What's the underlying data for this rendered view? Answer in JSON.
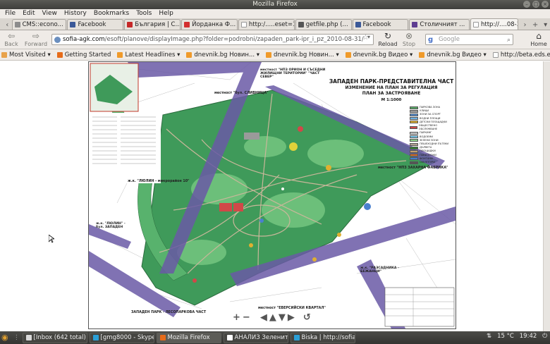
{
  "window": {
    "title": "Mozilla Firefox"
  },
  "menu": [
    "File",
    "Edit",
    "View",
    "History",
    "Bookmarks",
    "Tools",
    "Help"
  ],
  "tabs": [
    {
      "label": "CMS::econo...",
      "color": "#8c8c8c",
      "active": false
    },
    {
      "label": "Facebook",
      "color": "#3b5998",
      "active": false
    },
    {
      "label": "България | С...",
      "color": "#c62828",
      "active": false
    },
    {
      "label": "Йорданка Ф...",
      "color": "#d32f2f",
      "active": false
    },
    {
      "label": "http:/.....eset=1",
      "color": "#ffffff",
      "active": false
    },
    {
      "label": "getfile.php (...",
      "color": "#555555",
      "active": false
    },
    {
      "label": "Facebook",
      "color": "#3b5998",
      "active": false
    },
    {
      "label": "Столичният ...",
      "color": "#5e3d91",
      "active": false
    },
    {
      "label": "http://....08-31/",
      "color": "#ffffff",
      "active": true
    }
  ],
  "nav": {
    "back": "Back",
    "forward": "Forward",
    "reload": "Reload",
    "stop": "Stop",
    "home": "Home",
    "url_domain": "sofia-agk.com",
    "url_path": "/esoft/planove/displayImage.php?folder=podrobni/zapaden_park-ipr_i_pz_2010-08-31/",
    "search_placeholder": "Google"
  },
  "bookmarks": [
    {
      "label": "Most Visited",
      "has_menu": true,
      "color": "#e8a24a"
    },
    {
      "label": "Getting Started",
      "has_menu": false,
      "color": "#e66b1a"
    },
    {
      "label": "Latest Headlines",
      "has_menu": true,
      "color": "#f09a2a"
    },
    {
      "label": "dnevnik.bg Новин...",
      "has_menu": true,
      "color": "#f09a2a"
    },
    {
      "label": "dnevnik.bg Новин...",
      "has_menu": true,
      "color": "#f09a2a"
    },
    {
      "label": "dnevnik.bg Видео",
      "has_menu": true,
      "color": "#f09a2a"
    },
    {
      "label": "dnevnik.bg Видео",
      "has_menu": true,
      "color": "#f09a2a"
    },
    {
      "label": "http://beta.eds.econ...",
      "has_menu": false,
      "color": "#ffffff"
    }
  ],
  "map": {
    "title": "ЗАПАДЕН ПАРК-ПРЕДСТАВИТЕЛНА ЧАСТ",
    "subtitle1": "ИЗМЕНЕНИЕ НА ПЛАН ЗА РЕГУЛАЦИЯ",
    "subtitle2": "ПЛАН ЗА ЗАСТРОЯВАНЕ",
    "scale": "М 1:1000",
    "labels": {
      "top_street": "местност \"НПЗ ОРИОН И СЪСЕДНИ ЖИЛИЩНИ ТЕРИТОРИИ\" \"ЧАСТ СЕВЕР\"",
      "bus": "местност \"бул. СЛИВНИЦА\"",
      "factory": "местност \"НПЗ ЗАХАРНА ФАБРИКА\"",
      "lyulin": "ж.к. \"ЛЮЛИН - микрорайон 10\"",
      "lyulin2": "ж.к. \"ЛЮЛИН\" - бул. ЗАПАДЕН",
      "raz": "ж.к. \"РАЗСАДНИКА - БЕЖАНЦИ\"",
      "bottom1": "ЗАПАДЕН ПАРК - ЛЕСОПАРКОВА ЧАСТ",
      "bottom2": "местност \"ЕВЕРСИЙСКИ КВАРТАЛ\""
    },
    "legend": [
      "ПАРКОВА ЗОНА",
      "УЛИЦИ",
      "ЗОНИ ЗА СПОРТ",
      "ВОДНИ ПЛОЩИ",
      "ДЕТСКИ ПЛОЩАДКИ",
      "ОБЩЕСТВЕНО ОБСЛУЖВАНЕ",
      "ПАРКИНГ",
      "ВОДОЕМИ",
      "ЗЕЛЕНИ ЗОНИ",
      "ПЕШЕХОДНИ ПЪТЕКИ",
      "ДЪРВЕТА",
      "ПЛОЩАДКИ",
      "ПАВИЛИОНИ",
      "ФОНТАНИ",
      "СКУЛПТУРИ"
    ],
    "legend_colors": [
      "#58a865",
      "#9a9a9a",
      "#5a8fd0",
      "#6fb3e6",
      "#e0b030",
      "#d04848",
      "#c8c8c8",
      "#79c6e8",
      "#8fd08a",
      "#b0a090",
      "#2e7d32",
      "#c5a070",
      "#d26b2a",
      "#3f7fd0",
      "#555555"
    ],
    "nav_controls": [
      "zoom-in",
      "zoom-out",
      "pan-left",
      "pan-up",
      "pan-down",
      "pan-right",
      "rotate"
    ]
  },
  "taskbar": {
    "items": [
      {
        "label": "[Inbox (642 total) ...",
        "color": "#d9d9d9",
        "active": false
      },
      {
        "label": "[gmg8000 - Skype...",
        "color": "#2a9fd6",
        "active": false
      },
      {
        "label": "Mozilla Firefox",
        "color": "#e66b1a",
        "active": true
      },
      {
        "label": "АНАЛИЗ Зеленит...",
        "color": "#ffffff",
        "active": false
      },
      {
        "label": "Biska | http://sofia...",
        "color": "#2a9fd6",
        "active": false
      }
    ],
    "temp": "15 °C",
    "time": "19:42"
  },
  "colors": {
    "park": "#3f9a5a",
    "road": "#6a5aa6",
    "map_bg": "#ffffff"
  }
}
